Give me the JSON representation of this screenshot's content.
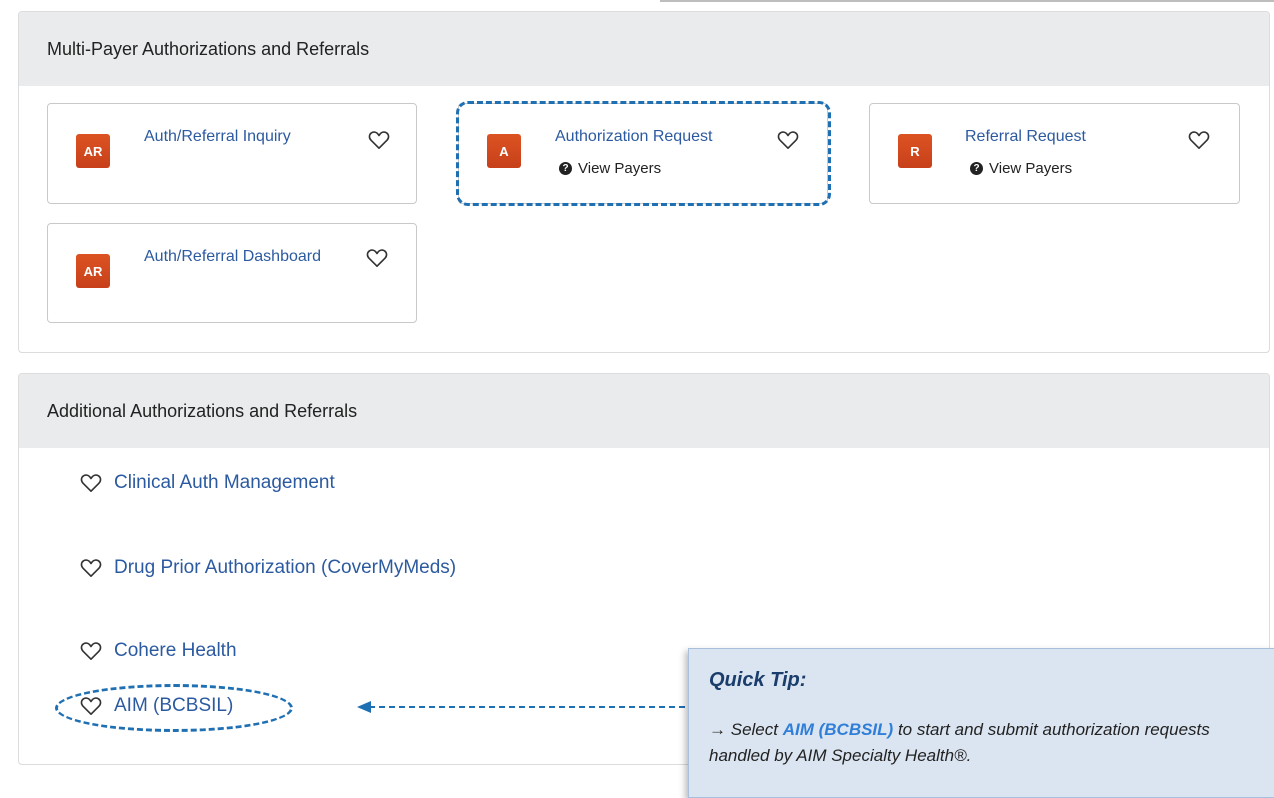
{
  "multi_payer": {
    "heading": "Multi-Payer Authorizations and Referrals",
    "cards": [
      {
        "badge": "AR",
        "title": "Auth/Referral Inquiry"
      },
      {
        "badge": "A",
        "title": "Authorization Request",
        "sub": "View Payers"
      },
      {
        "badge": "R",
        "title": "Referral Request",
        "sub": "View Payers"
      },
      {
        "badge": "AR",
        "title": "Auth/Referral Dashboard"
      }
    ]
  },
  "additional": {
    "heading": "Additional Authorizations and Referrals",
    "links": [
      "Clinical Auth Management",
      "Drug Prior Authorization (CoverMyMeds)",
      "Cohere Health",
      "AIM (BCBSIL)"
    ]
  },
  "quick_tip": {
    "title": "Quick Tip:",
    "arrow": "→",
    "pre": "Select",
    "highlight": "AIM (BCBSIL)",
    "post": "to start and submit authorization requests handled by AIM Specialty Health®."
  },
  "colors": {
    "accent": "#1f6fb3",
    "badge": "#d84a1b",
    "link": "#2c5aa0",
    "tip_background": "#dbe5f1"
  },
  "icons": {
    "favorite": "heart-outline-icon",
    "help": "question-circle-icon"
  }
}
